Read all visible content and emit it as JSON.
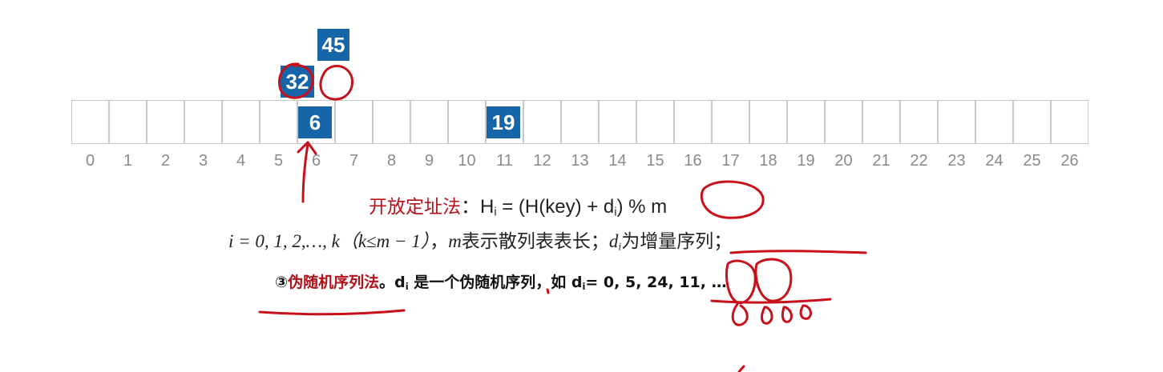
{
  "table": {
    "indices": [
      "0",
      "1",
      "2",
      "3",
      "4",
      "5",
      "6",
      "7",
      "8",
      "9",
      "10",
      "11",
      "12",
      "13",
      "14",
      "15",
      "16",
      "17",
      "18",
      "19",
      "20",
      "21",
      "22",
      "23",
      "24",
      "25",
      "26"
    ]
  },
  "keys": {
    "in_table": [
      {
        "value": "6",
        "slot": 6
      },
      {
        "value": "19",
        "slot": 11
      }
    ],
    "probing": [
      {
        "value": "32"
      },
      {
        "value": "45"
      }
    ]
  },
  "formula": {
    "title": "开放定址法",
    "colon": "：",
    "h": "H",
    "sub_i": "i",
    "eq": " = (H(key) + d",
    "tail": ") % m"
  },
  "condition": {
    "part1": "i = 0, 1, 2,…, k（k≤m − 1）",
    "part2": "，",
    "m": "m",
    "part3": "表示散列表表长；",
    "d": "d",
    "sub_i": "i",
    "part4": "为增量序列；"
  },
  "method3": {
    "num": "③",
    "name": "伪随机序列法",
    "period": "。",
    "d": "d",
    "sub_i": "i",
    "desc": " 是一个伪随机序列，如 d",
    "seq": "= 0, 5, 24, 11, …"
  },
  "colors": {
    "cell_border": "#c8c8c8",
    "key_fill": "#1565a8",
    "index_text": "#8a8a8a",
    "title_red": "#b3111a",
    "ink_red": "#c8101a"
  }
}
